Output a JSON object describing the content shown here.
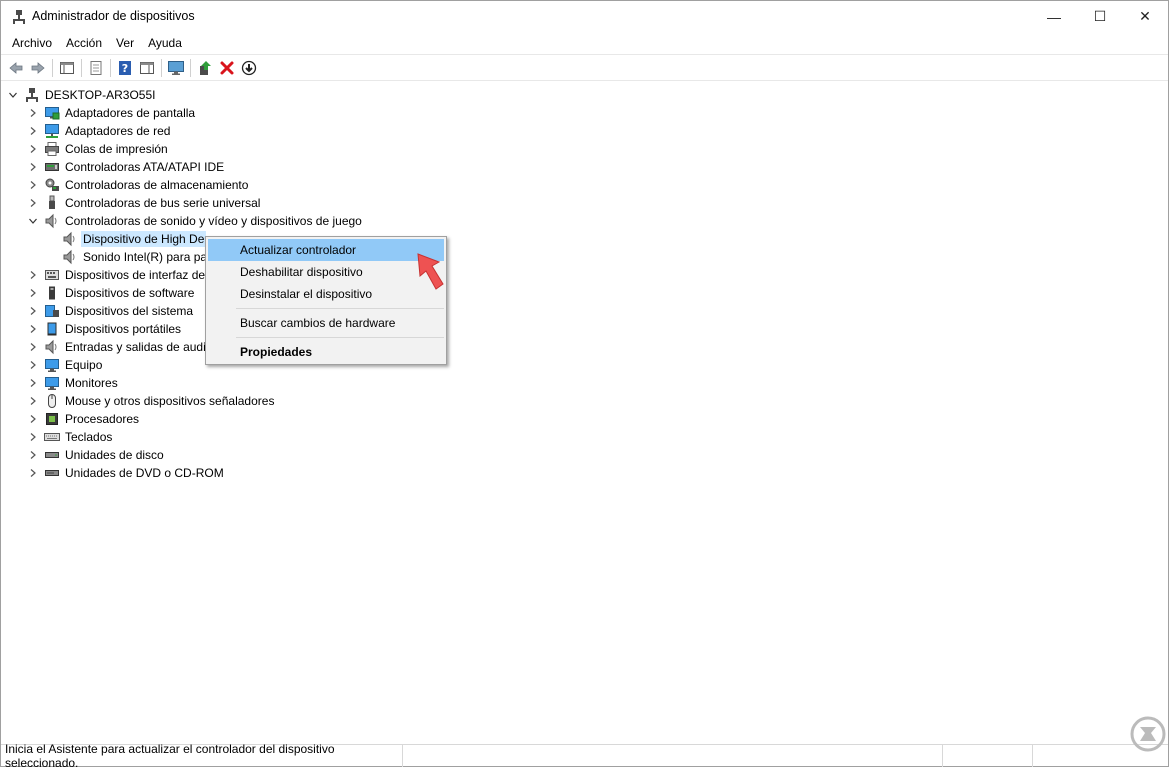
{
  "window": {
    "title": "Administrador de dispositivos",
    "minimize": "—",
    "maximize": "☐",
    "close": "✕"
  },
  "menu": [
    "Archivo",
    "Acción",
    "Ver",
    "Ayuda"
  ],
  "toolbar": {
    "icons": [
      "back-arrow-icon",
      "forward-arrow-icon",
      "console-tree-icon",
      "properties-icon",
      "help-icon",
      "view-icon",
      "monitor-icon",
      "update-driver-icon",
      "uninstall-icon",
      "download-icon"
    ]
  },
  "tree": {
    "root": "DESKTOP-AR3O55I",
    "items": [
      {
        "label": "Adaptadores de pantalla",
        "icon": "display-adapter-icon"
      },
      {
        "label": "Adaptadores de red",
        "icon": "network-adapter-icon"
      },
      {
        "label": "Colas de impresión",
        "icon": "print-queue-icon"
      },
      {
        "label": "Controladoras ATA/ATAPI IDE",
        "icon": "ide-controller-icon"
      },
      {
        "label": "Controladoras de almacenamiento",
        "icon": "storage-controller-icon"
      },
      {
        "label": "Controladoras de bus serie universal",
        "icon": "usb-icon"
      },
      {
        "label": "Controladoras de sonido y vídeo y dispositivos de juego",
        "icon": "speaker-icon",
        "expanded": true,
        "children": [
          {
            "label": "Dispositivo de High Definition Audio",
            "visible": "Dispositivo de High De",
            "selected": true
          },
          {
            "label": "Sonido Intel(R) para pantallas",
            "visible": "Sonido Intel(R) para pa"
          }
        ]
      },
      {
        "label": "Dispositivos de interfaz de",
        "icon": "hid-icon"
      },
      {
        "label": "Dispositivos de software",
        "icon": "software-device-icon"
      },
      {
        "label": "Dispositivos del sistema",
        "icon": "system-device-icon"
      },
      {
        "label": "Dispositivos portátiles",
        "icon": "portable-device-icon"
      },
      {
        "label": "Entradas y salidas de audio",
        "visible": "Entradas y salidas de audic",
        "icon": "audio-io-icon"
      },
      {
        "label": "Equipo",
        "icon": "computer-icon"
      },
      {
        "label": "Monitores",
        "icon": "monitor-icon"
      },
      {
        "label": "Mouse y otros dispositivos señaladores",
        "icon": "mouse-icon"
      },
      {
        "label": "Procesadores",
        "icon": "processor-icon"
      },
      {
        "label": "Teclados",
        "icon": "keyboard-icon"
      },
      {
        "label": "Unidades de disco",
        "icon": "disk-drive-icon"
      },
      {
        "label": "Unidades de DVD o CD-ROM",
        "icon": "dvd-drive-icon"
      }
    ]
  },
  "context_menu": {
    "update": "Actualizar controlador",
    "disable": "Deshabilitar dispositivo",
    "uninstall": "Desinstalar el dispositivo",
    "scan": "Buscar cambios de hardware",
    "properties": "Propiedades"
  },
  "status": {
    "text": "Inicia el Asistente para actualizar el controlador del dispositivo seleccionado."
  },
  "colors": {
    "selection": "#cce8ff",
    "menu_highlight": "#91c9f7",
    "pointer_arrow": "#e84c4c"
  }
}
